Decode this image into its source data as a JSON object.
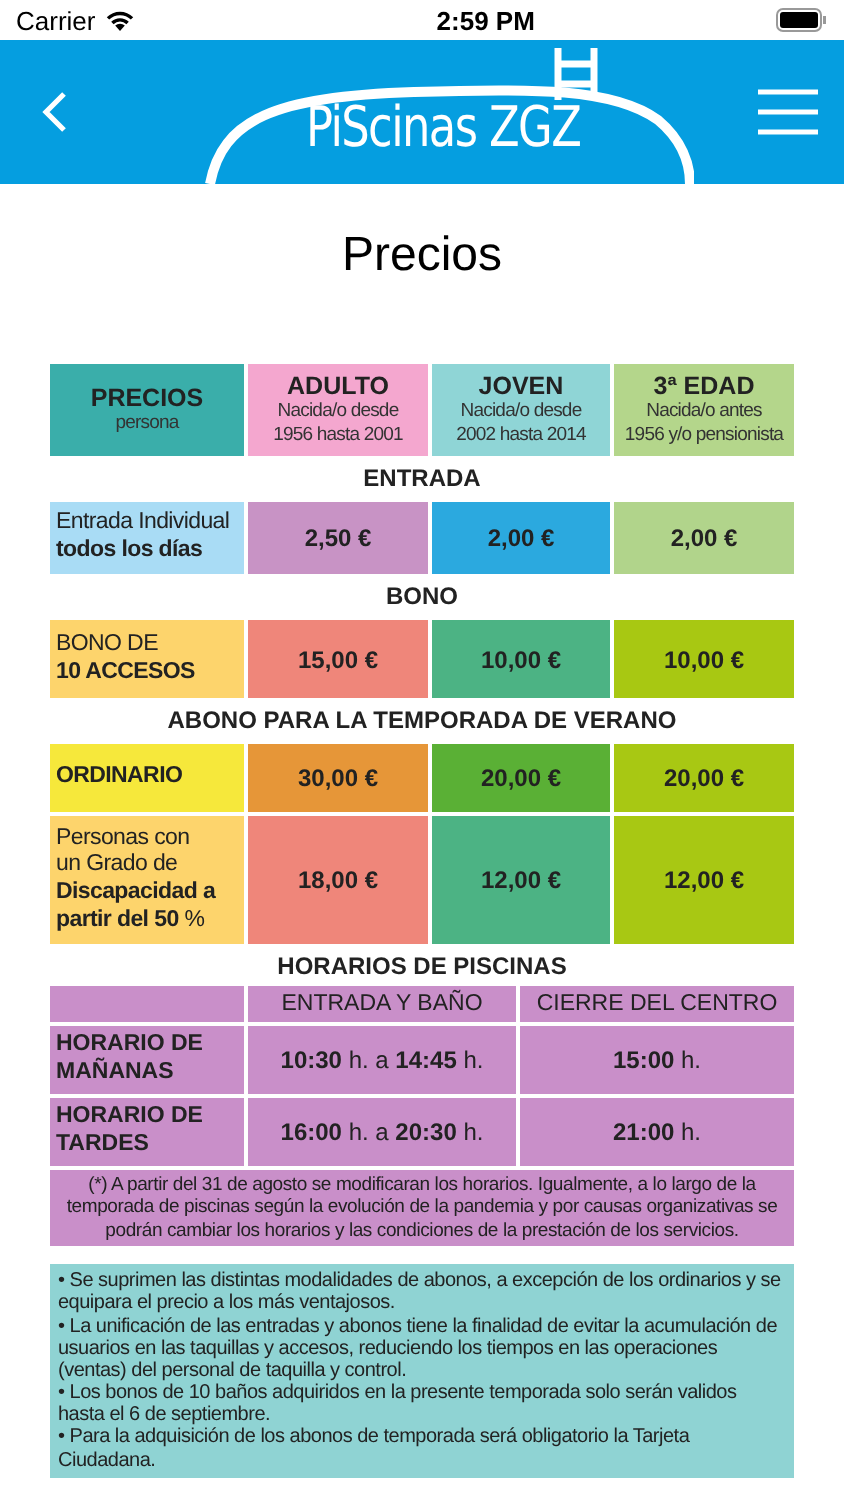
{
  "status_bar": {
    "carrier": "Carrier",
    "time": "2:59 PM"
  },
  "header": {
    "logo": "PiScinas ZGZ"
  },
  "title": "Precios",
  "price_table": {
    "corner": {
      "title": "PRECIOS",
      "subtitle": "persona",
      "color": "#3aaeaa"
    },
    "columns": [
      {
        "title": "ADULTO",
        "subtitle": "Nacida/o desde\n1956 hasta 2001",
        "color": "#f4a7cf"
      },
      {
        "title": "JOVEN",
        "subtitle": "Nacida/o desde\n2002 hasta 2014",
        "color": "#8fd5d6"
      },
      {
        "title": "3ª EDAD",
        "subtitle": "Nacida/o antes\n1956 y/o pensionista",
        "color": "#b4d68b"
      }
    ],
    "sections": [
      {
        "title": "ENTRADA",
        "rows": [
          {
            "label": "Entrada Individual\n**todos los días**",
            "color": "#a9dcf5",
            "cells": [
              {
                "value": "2,50 €",
                "color": "#c893c5"
              },
              {
                "value": "2,00 €",
                "color": "#2ba9df"
              },
              {
                "value": "2,00 €",
                "color": "#b1d48b"
              }
            ]
          }
        ]
      },
      {
        "title": "BONO",
        "rows": [
          {
            "label": "BONO DE\n**10 ACCESOS**",
            "color": "#fdd46c",
            "cells": [
              {
                "value": "15,00 €",
                "color": "#ef867a"
              },
              {
                "value": "10,00 €",
                "color": "#4cb384"
              },
              {
                "value": "10,00 €",
                "color": "#a8c812"
              }
            ]
          }
        ]
      },
      {
        "title": "ABONO PARA LA TEMPORADA DE VERANO",
        "rows": [
          {
            "label": "**ORDINARIO**",
            "color": "#f6e83b",
            "cells": [
              {
                "value": "30,00 €",
                "color": "#e69638"
              },
              {
                "value": "20,00 €",
                "color": "#5ab035"
              },
              {
                "value": "20,00 €",
                "color": "#a8c813"
              }
            ]
          },
          {
            "label": "Personas con\nun Grado de\n**Discapacidad a\npartir del 50** %",
            "color": "#fdd46c",
            "cells": [
              {
                "value": "18,00 €",
                "color": "#ef867a"
              },
              {
                "value": "12,00 €",
                "color": "#4cb384"
              },
              {
                "value": "12,00 €",
                "color": "#a8c813"
              }
            ]
          }
        ]
      }
    ]
  },
  "schedule": {
    "title": "HORARIOS DE PISCINAS",
    "columns": [
      "ENTRADA Y BAÑO",
      "CIERRE DEL CENTRO"
    ],
    "rows": [
      {
        "label": "HORARIO DE\nMAÑANAS",
        "cells": [
          "**10:30** h. a **14:45** h.",
          "**15:00** h."
        ]
      },
      {
        "label": "HORARIO DE\nTARDES",
        "cells": [
          "**16:00** h. a **20:30** h.",
          "**21:00** h."
        ]
      }
    ],
    "footnote": "(*)  A partir del 31 de agosto se modificaran los horarios. Igualmente, a lo largo de la temporada de piscinas según la evolución de la pandemia y por causas organizativas se podrán cambiar los horarios y las condiciones de la prestación de los servicios."
  },
  "notes": [
    "• Se suprimen las distintas modalidades de abonos, a excepción de los ordinarios y se equipara el precio a los más ventajosos.",
    "• La unificación de las entradas y abonos tiene la finalidad de evitar la acumulación de usuarios en las taquillas y accesos, reduciendo los tiempos en las operaciones (ventas) del personal de taquilla y control.",
    "• Los bonos de 10 baños adquiridos en la presente temporada solo serán validos hasta el 6 de septiembre.",
    "• Para la adquisición de los abonos de temporada será obligatorio la Tarjeta Ciudadana."
  ]
}
